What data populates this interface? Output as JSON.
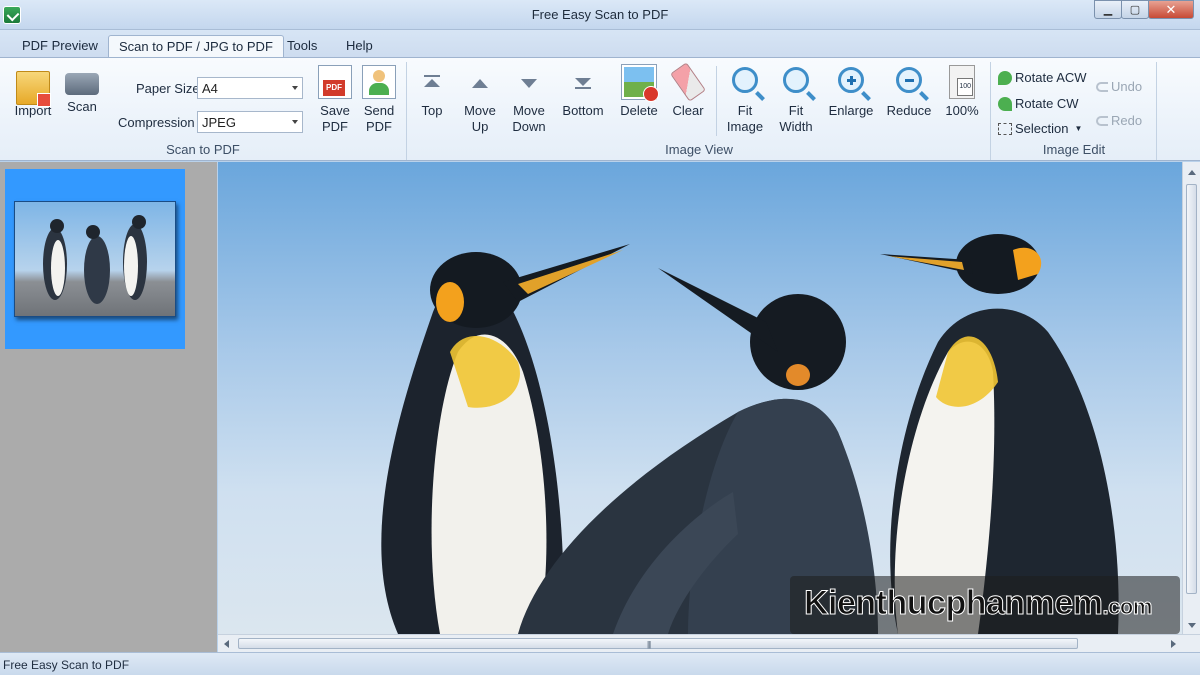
{
  "window": {
    "title": "Free Easy Scan to PDF",
    "buttons": {
      "minimize": "▁",
      "maximize": "▢",
      "close": "✕"
    }
  },
  "tabs": [
    {
      "label": "PDF Preview"
    },
    {
      "label": "Scan to PDF / JPG to PDF",
      "active": true
    },
    {
      "label": "Tools"
    },
    {
      "label": "Help"
    }
  ],
  "ribbon": {
    "scan_to_pdf": {
      "label": "Scan to PDF",
      "import": "Import",
      "scan": "Scan",
      "paper_size_label": "Paper Size",
      "paper_size_value": "A4",
      "compression_label": "Compression",
      "compression_value": "JPEG",
      "save_pdf_1": "Save",
      "save_pdf_2": "PDF",
      "send_pdf_1": "Send",
      "send_pdf_2": "PDF"
    },
    "image_view": {
      "label": "Image View",
      "top": "Top",
      "move_up_1": "Move",
      "move_up_2": "Up",
      "move_down_1": "Move",
      "move_down_2": "Down",
      "bottom": "Bottom",
      "delete": "Delete",
      "clear": "Clear",
      "fit_image_1": "Fit",
      "fit_image_2": "Image",
      "fit_width_1": "Fit",
      "fit_width_2": "Width",
      "enlarge": "Enlarge",
      "reduce": "Reduce",
      "zoom_100": "100%"
    },
    "image_edit": {
      "label": "Image Edit",
      "rotate_acw": "Rotate ACW",
      "rotate_cw": "Rotate CW",
      "selection": "Selection",
      "undo": "Undo",
      "redo": "Redo"
    }
  },
  "statusbar": {
    "text": "Free Easy Scan to PDF"
  },
  "watermark": {
    "text": "Kienthucphanmem",
    "suffix": ".com"
  },
  "colors": {
    "selection": "#3399ff",
    "ribbon_bg": "#e5eef8",
    "panel_bg": "#ababab"
  }
}
